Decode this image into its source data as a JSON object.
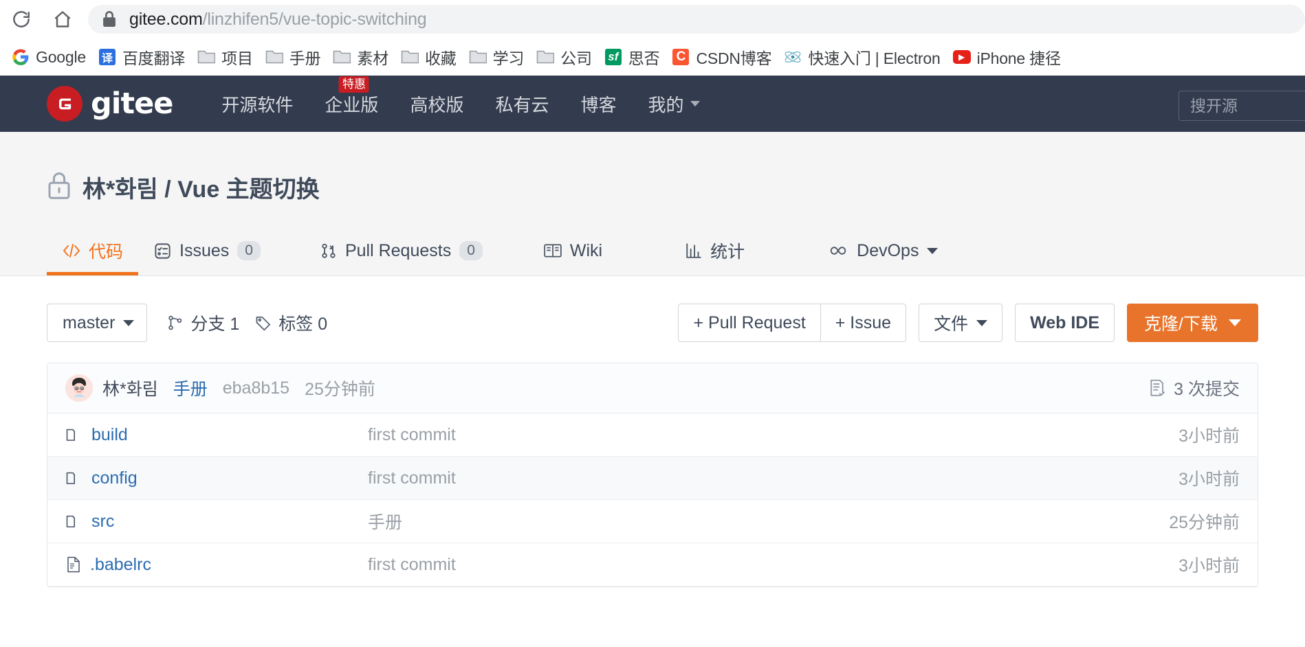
{
  "browser": {
    "reload_icon": "reload-icon",
    "home_icon": "home-icon",
    "lock_icon": "lock-icon",
    "url_domain": "gitee.com",
    "url_path": "/linzhifen5/vue-topic-switching",
    "bookmarks": [
      {
        "label": "Google",
        "icon": "google-icon",
        "icon_text": "G",
        "color": "#4285f4"
      },
      {
        "label": "百度翻译",
        "icon": "translate-icon",
        "icon_text": "译",
        "color": "#2b6fe0"
      },
      {
        "label": "项目",
        "icon": "folder-icon",
        "icon_text": "",
        "color": "#dadce0"
      },
      {
        "label": "手册",
        "icon": "folder-icon",
        "icon_text": "",
        "color": "#dadce0"
      },
      {
        "label": "素材",
        "icon": "folder-icon",
        "icon_text": "",
        "color": "#dadce0"
      },
      {
        "label": "收藏",
        "icon": "folder-icon",
        "icon_text": "",
        "color": "#dadce0"
      },
      {
        "label": "学习",
        "icon": "folder-icon",
        "icon_text": "",
        "color": "#dadce0"
      },
      {
        "label": "公司",
        "icon": "folder-icon",
        "icon_text": "",
        "color": "#dadce0"
      },
      {
        "label": "思否",
        "icon": "segmentfault-icon",
        "icon_text": "sf",
        "color": "#009a61"
      },
      {
        "label": "CSDN博客",
        "icon": "csdn-icon",
        "icon_text": "C",
        "color": "#fc5531"
      },
      {
        "label": "快速入门 | Electron",
        "icon": "electron-icon",
        "icon_text": "",
        "color": "#9feaf9"
      },
      {
        "label": "iPhone 捷径",
        "icon": "youtube-icon",
        "icon_text": "▶",
        "color": "#e62117"
      }
    ]
  },
  "gitee_nav": {
    "logo_text": "gitee",
    "logo_mark": "G",
    "items": [
      {
        "label": "开源软件",
        "badge": ""
      },
      {
        "label": "企业版",
        "badge": "特惠"
      },
      {
        "label": "高校版",
        "badge": ""
      },
      {
        "label": "私有云",
        "badge": ""
      },
      {
        "label": "博客",
        "badge": ""
      },
      {
        "label": "我的",
        "badge": "",
        "caret": true
      }
    ],
    "search_placeholder": "搜开源"
  },
  "repo": {
    "visibility_icon": "lock-icon",
    "title": "林*화림 / Vue 主题切换",
    "tabs": [
      {
        "label": "代码",
        "icon": "code-icon",
        "count": "",
        "active": true,
        "caret": false
      },
      {
        "label": "Issues",
        "icon": "issue-icon",
        "count": "0",
        "active": false,
        "caret": false
      },
      {
        "label": "Pull Requests",
        "icon": "pull-request-icon",
        "count": "0",
        "active": false,
        "caret": false
      },
      {
        "label": "Wiki",
        "icon": "book-icon",
        "count": "",
        "active": false,
        "caret": false
      },
      {
        "label": "统计",
        "icon": "chart-icon",
        "count": "",
        "active": false,
        "caret": false
      },
      {
        "label": "DevOps",
        "icon": "infinity-icon",
        "count": "",
        "active": false,
        "caret": true
      }
    ]
  },
  "toolbar": {
    "branch_label": "master",
    "branches_label": "分支 1",
    "tags_label": "标签 0",
    "pull_request_label": "+ Pull Request",
    "issue_label": "+ Issue",
    "files_label": "文件",
    "web_ide_label": "Web IDE",
    "clone_label": "克隆/下载"
  },
  "commit_bar": {
    "author": "林*화림",
    "message": "手册",
    "sha": "eba8b15",
    "time": "25分钟前",
    "commits_count": "3 次提交",
    "commits_icon": "commit-list-icon"
  },
  "files": [
    {
      "name": "build",
      "type": "folder",
      "message": "first commit",
      "time": "3小时前"
    },
    {
      "name": "config",
      "type": "folder",
      "message": "first commit",
      "time": "3小时前"
    },
    {
      "name": "src",
      "type": "folder",
      "message": "手册",
      "time": "25分钟前"
    },
    {
      "name": ".babelrc",
      "type": "file",
      "message": "first commit",
      "time": "3小时前"
    }
  ],
  "colors": {
    "gitee_dark": "#333c4e",
    "gitee_red": "#c71d23",
    "accent_orange": "#f1721d",
    "link_blue": "#2b6cb0"
  }
}
